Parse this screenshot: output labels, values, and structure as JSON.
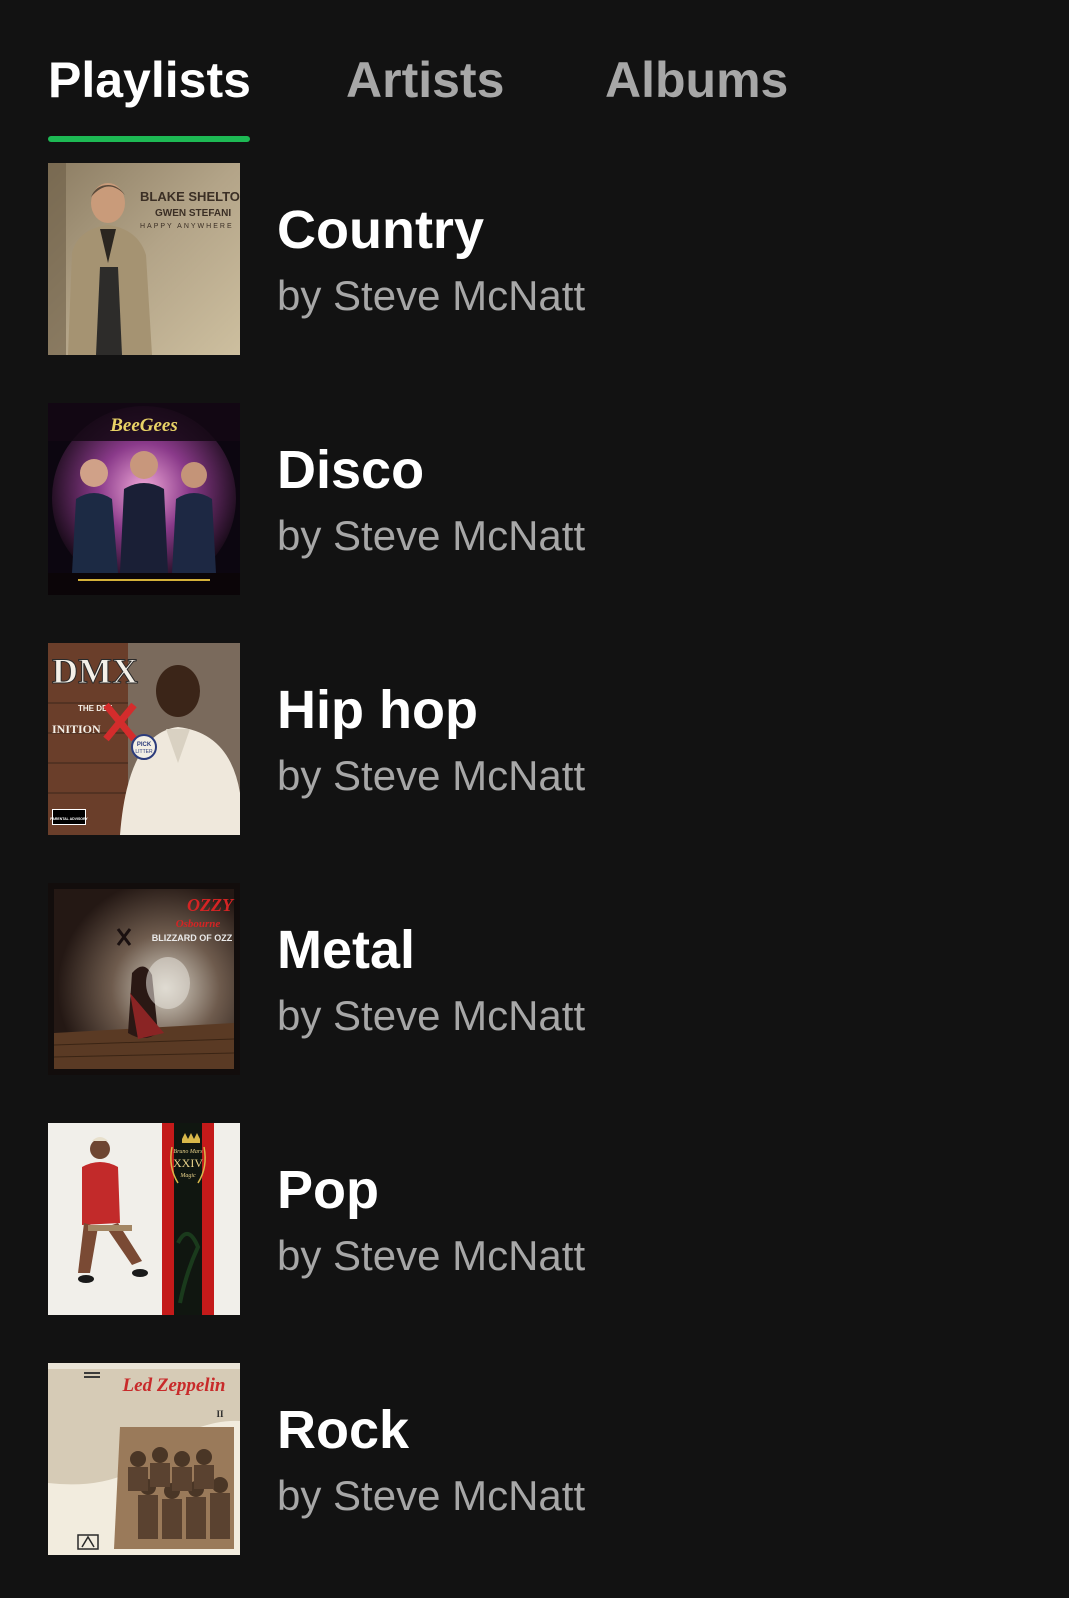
{
  "tabs": [
    {
      "label": "Playlists",
      "active": true
    },
    {
      "label": "Artists",
      "active": false
    },
    {
      "label": "Albums",
      "active": false
    }
  ],
  "accent_color": "#1db954",
  "playlists": [
    {
      "title": "Country",
      "subtitle": "by Steve McNatt",
      "cover": {
        "art": "album-cover-blake-shelton",
        "text_lines": [
          "BLAKE SHELTON",
          "GWEN STEFANI",
          "HAPPY ANYWHERE"
        ]
      }
    },
    {
      "title": "Disco",
      "subtitle": "by Steve McNatt",
      "cover": {
        "art": "album-cover-bee-gees",
        "text_lines": [
          "BeeGees"
        ]
      }
    },
    {
      "title": "Hip hop",
      "subtitle": "by Steve McNatt",
      "cover": {
        "art": "album-cover-dmx",
        "text_lines": [
          "DMX",
          "THE DEF",
          "INITION",
          "OF",
          "PICK",
          "LITTER",
          "PARENTAL ADVISORY"
        ]
      }
    },
    {
      "title": "Metal",
      "subtitle": "by Steve McNatt",
      "cover": {
        "art": "album-cover-ozzy",
        "text_lines": [
          "OZZY",
          "Osbourne",
          "BLIZZARD OF OZZ"
        ]
      }
    },
    {
      "title": "Pop",
      "subtitle": "by Steve McNatt",
      "cover": {
        "art": "album-cover-bruno-mars",
        "text_lines": [
          "Bruno Mars",
          "XXIV",
          "Magic"
        ]
      }
    },
    {
      "title": "Rock",
      "subtitle": "by Steve McNatt",
      "cover": {
        "art": "album-cover-led-zeppelin",
        "text_lines": [
          "Led Zeppelin",
          "II"
        ]
      }
    }
  ]
}
